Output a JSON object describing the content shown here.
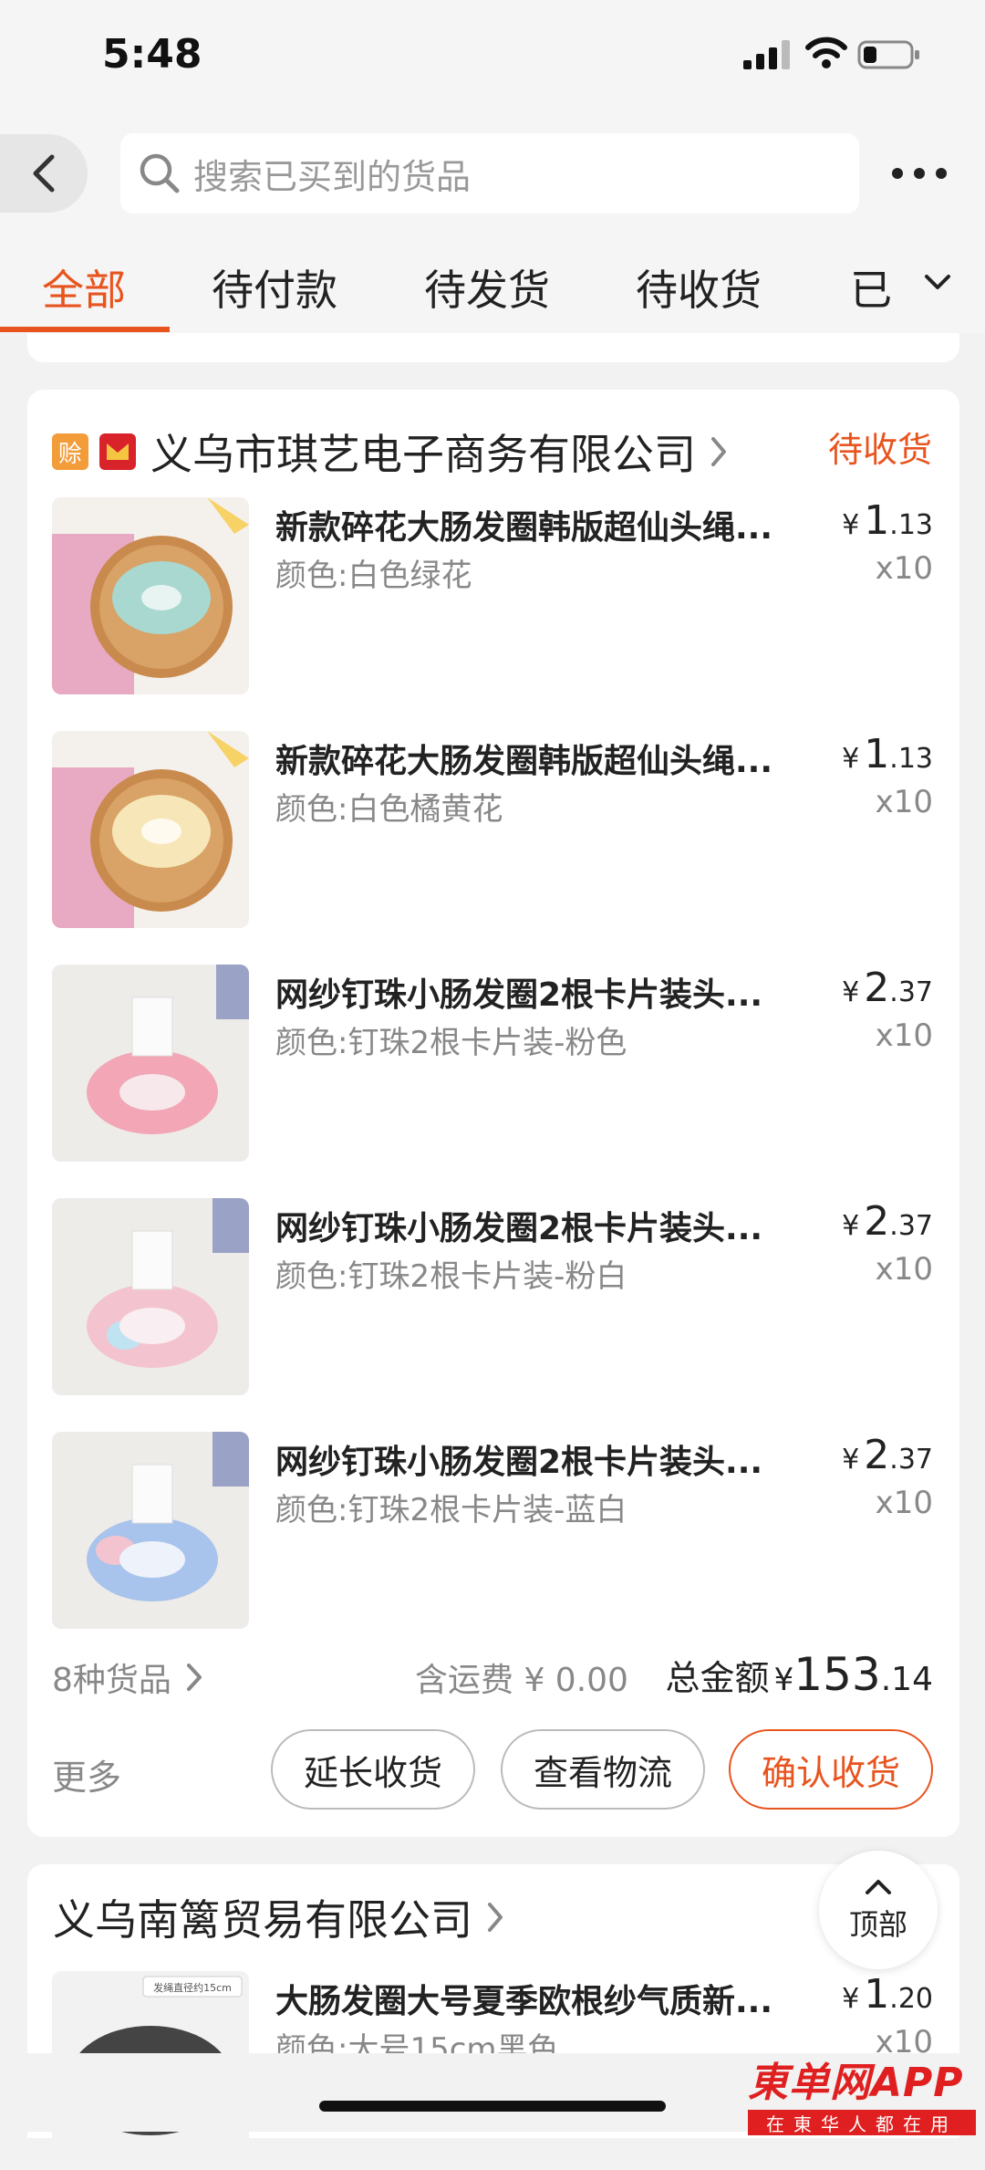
{
  "status_bar": {
    "time": "5:48"
  },
  "search": {
    "placeholder": "搜索已买到的货品"
  },
  "tabs": [
    {
      "label": "全部",
      "active": true
    },
    {
      "label": "待付款",
      "active": false
    },
    {
      "label": "待发货",
      "active": false
    },
    {
      "label": "待收货",
      "active": false
    },
    {
      "label": "已",
      "active": false
    }
  ],
  "order1": {
    "badge_pay": "赊",
    "shop_name": "义乌市琪艺电子商务有限公司",
    "status": "待收货",
    "items": [
      {
        "title": "新款碎花大肠发圈韩版超仙头绳...",
        "spec": "颜色:白色绿花",
        "price_cur": "¥",
        "price_int": "1",
        "price_dec": ".13",
        "qty": "x10",
        "thumb_color": "#a8d8d0"
      },
      {
        "title": "新款碎花大肠发圈韩版超仙头绳...",
        "spec": "颜色:白色橘黄花",
        "price_cur": "¥",
        "price_int": "1",
        "price_dec": ".13",
        "qty": "x10",
        "thumb_color": "#f4d49a"
      },
      {
        "title": "网纱钉珠小肠发圈2根卡片装头...",
        "spec": "颜色:钉珠2根卡片装-粉色",
        "price_cur": "¥",
        "price_int": "2",
        "price_dec": ".37",
        "qty": "x10",
        "thumb_color": "#f2a6b6"
      },
      {
        "title": "网纱钉珠小肠发圈2根卡片装头...",
        "spec": "颜色:钉珠2根卡片装-粉白",
        "price_cur": "¥",
        "price_int": "2",
        "price_dec": ".37",
        "qty": "x10",
        "thumb_color": "#f3c4cf"
      },
      {
        "title": "网纱钉珠小肠发圈2根卡片装头...",
        "spec": "颜色:钉珠2根卡片装-蓝白",
        "price_cur": "¥",
        "price_int": "2",
        "price_dec": ".37",
        "qty": "x10",
        "thumb_color": "#a9c4ec"
      }
    ],
    "item_count": "8种货品",
    "shipping": "含运费 ¥ 0.00",
    "total_label": "总金额",
    "total_cur": "¥",
    "total_int": "153",
    "total_dec": ".14",
    "more": "更多",
    "buttons": {
      "extend": "延长收货",
      "logistics": "查看物流",
      "confirm": "确认收货"
    }
  },
  "order2": {
    "shop_name": "义乌南篱贸易有限公司",
    "item": {
      "title": "大肠发圈大号夏季欧根纱气质新...",
      "spec": "颜色:大号15cm黑色",
      "price_cur": "¥",
      "price_int": "1",
      "price_dec": ".20",
      "qty": "x10",
      "thumb_label": "发绳直径约15cm"
    }
  },
  "to_top": {
    "label": "顶部"
  },
  "watermark": {
    "main": "東单网APP",
    "sub": "在東华人都在用"
  },
  "colors": {
    "accent": "#e8541e",
    "page_bg": "#f2f2f2"
  }
}
